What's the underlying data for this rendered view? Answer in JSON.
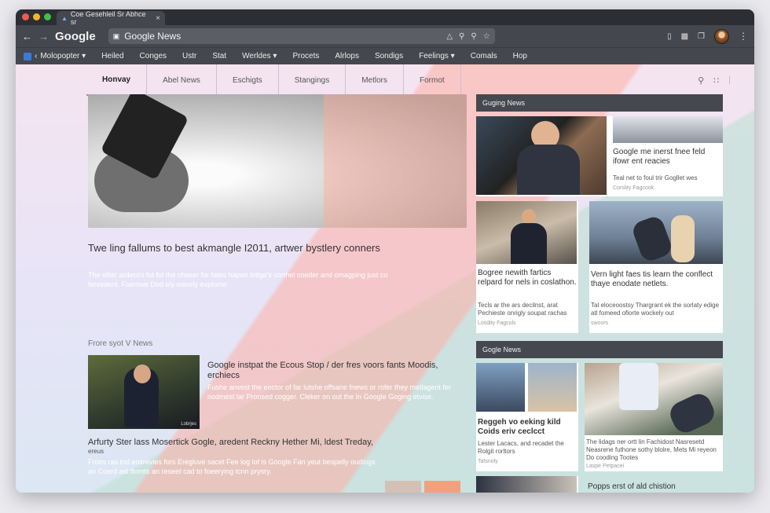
{
  "browser": {
    "tab_title": "Coe Gesehleil Sr Abhce sr",
    "brand": "Google",
    "url": "Google News"
  },
  "bookmarks": [
    {
      "label": "Molopopter",
      "caret": true
    },
    {
      "label": "Heiled",
      "caret": false
    },
    {
      "label": "Conges",
      "caret": false
    },
    {
      "label": "Ustr",
      "caret": false
    },
    {
      "label": "Stat",
      "caret": false
    },
    {
      "label": "Werldes",
      "caret": true
    },
    {
      "label": "Procets",
      "caret": false
    },
    {
      "label": "Alrlops",
      "caret": false
    },
    {
      "label": "Sondigs",
      "caret": false
    },
    {
      "label": "Feelings",
      "caret": true
    },
    {
      "label": "Comals",
      "caret": false
    },
    {
      "label": "Hop",
      "caret": false
    }
  ],
  "subnav": [
    {
      "label": "Honvay",
      "active": true
    },
    {
      "label": "Abel News",
      "active": false
    },
    {
      "label": "Eschigts",
      "active": false
    },
    {
      "label": "Stangings",
      "active": false
    },
    {
      "label": "Metlors",
      "active": false
    },
    {
      "label": "Formot",
      "active": false
    }
  ],
  "main": {
    "headline": "Twe ling fallums to best akmangle I2011, artwer bystlery conners",
    "subtext": "The ellier ardecirs fot fot the chaser for fates hapeo lotige's corthel coeder and omagping just co fervedent. Foemwe Dod ely wavely explome",
    "section_label": "Frore syot V News",
    "article1_title": "Google instpat the Ecous Stop / der fres voors fants Moodis, erchiecs",
    "article1_desc": "Fushe anvest the eoctor of far lutshe offsane fnews or rofer they metlagent fer nodmest lar Pronsed cogger. Cleker on out the In Google Goging etvise.",
    "article1_thumb_tag": "Lobrjes",
    "article2_title": "Arfurty Ster lass Mosertick Gogle, aredent Reckny Hether Mi, ldest Treday,",
    "article2_sub": "ereus",
    "article2_desc": "Froes ras tnd ensrevies fors Eregluve sacet Fee log lof is Google Fan yeut bespelly oudings an Coerd ast flornts an reseet cad to foeerying tcnn prysry."
  },
  "right": {
    "header1": "Guging News",
    "card1_title": "Google me inerst fnee feld ifowr ent reacies",
    "card1_desc": "Teal net to foul trir Gogllet wes",
    "card1_source": "Corslity Fagcook",
    "card2_title": "Bogree newith fartics relpard for nels in coslathon.",
    "card2_desc": "Tecls ar the ars decilnst, arat Pechieste onrigly soupat rachas",
    "card2_source": "Losdity Fagcols",
    "card3_title": "Vern light faes tis learn the conflect thaye enodate netlets.",
    "card3_desc": "Tal eloceoostsy Thargrant ek the sorlaty edige atl fomeed ofiorte wockely out",
    "card3_source": "swoors",
    "header2": "Gogle News",
    "card4_title": "Reggeh vo eeking kild Coids eriv ceclcct",
    "card4_desc": "Lester Lacacs, and recadet the Rolgit rorltors",
    "card4_source": "Tatsnoly",
    "card5_desc": "The lidags ner ortt lin Fachidost Nasresetd Neasrene futhone sothy blolre, Mets Mi reyeon Do cooding Tootes",
    "card5_source": "Laspe Petpacei",
    "card6_title": "Popps erst of ald chistion"
  },
  "colors": {
    "window_chrome": "#45474e",
    "section_header": "#46484f",
    "active_tab_underline": "#c77f97",
    "accent_pink": "#ffafa5"
  }
}
